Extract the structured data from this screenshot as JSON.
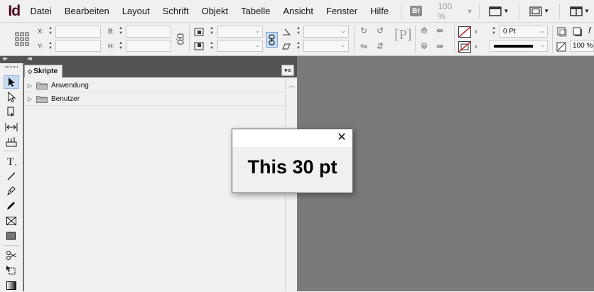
{
  "app": {
    "logo": "Id"
  },
  "menu": {
    "items": [
      "Datei",
      "Bearbeiten",
      "Layout",
      "Schrift",
      "Objekt",
      "Tabelle",
      "Ansicht",
      "Fenster",
      "Hilfe"
    ],
    "bridge_badge": "Br",
    "zoom": "100 %"
  },
  "control": {
    "x_label": "X:",
    "y_label": "Y:",
    "w_label": "B:",
    "h_label": "H:",
    "stroke_weight": "0 Pt",
    "scale": "100 %"
  },
  "scripts_panel": {
    "tab_label": "Skripte",
    "folders": [
      "Anwendung",
      "Benutzer"
    ]
  },
  "dialog": {
    "close": "✕",
    "message": "This 30 pt"
  },
  "colors": {
    "canvas": "#7a7a7a",
    "panel_dark": "#535353",
    "tool_active": "#c6dbf2",
    "logo": "#49021f",
    "no_fill_red": "#c0262c"
  }
}
